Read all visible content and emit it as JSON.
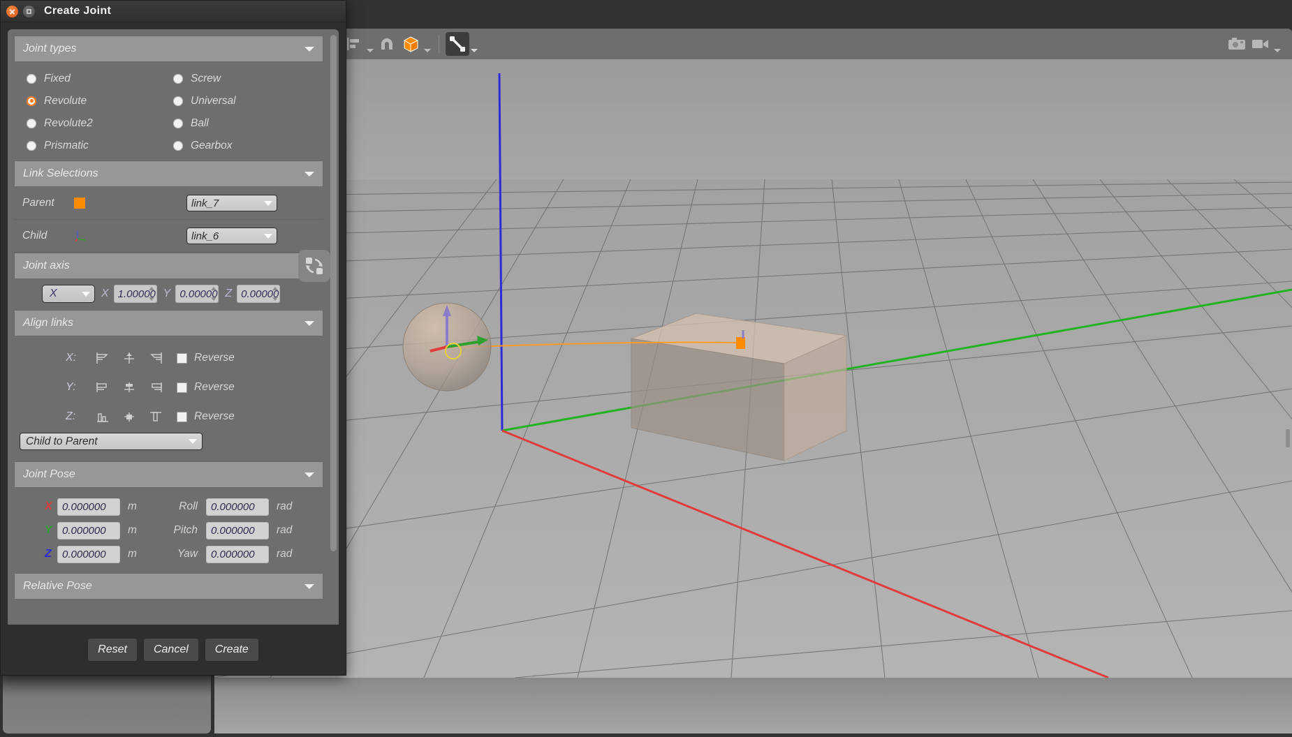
{
  "window": {
    "title": "Create Joint",
    "close_icon": "close-icon",
    "maximize_icon": "maximize-icon"
  },
  "toolbar": {
    "items": [
      {
        "name": "redo-button",
        "icon": "redo-arrow-icon",
        "has_caret": true
      },
      {
        "name": "copy-button",
        "icon": "copy-icon",
        "has_caret": false
      },
      {
        "name": "paste-button",
        "icon": "paste-icon",
        "has_caret": false
      },
      {
        "name": "align-button",
        "icon": "align-icon",
        "has_caret": true
      },
      {
        "name": "snap-button",
        "icon": "magnet-icon",
        "has_caret": false
      },
      {
        "name": "shape-button",
        "icon": "cube-icon",
        "has_caret": true
      },
      {
        "name": "joint-button",
        "icon": "joint-link-icon",
        "has_caret": true,
        "active": true
      }
    ],
    "right_items": [
      {
        "name": "screenshot-button",
        "icon": "camera-icon"
      },
      {
        "name": "record-video-button",
        "icon": "video-camera-icon",
        "has_caret": true
      }
    ],
    "accent_color": "#ff8c00"
  },
  "groups": {
    "joint_types": {
      "title": "Joint types",
      "options": [
        {
          "label": "Fixed",
          "selected": false
        },
        {
          "label": "Screw",
          "selected": false
        },
        {
          "label": "Revolute",
          "selected": true
        },
        {
          "label": "Universal",
          "selected": false
        },
        {
          "label": "Revolute2",
          "selected": false
        },
        {
          "label": "Ball",
          "selected": false
        },
        {
          "label": "Prismatic",
          "selected": false
        },
        {
          "label": "Gearbox",
          "selected": false
        }
      ],
      "selected_value": "Revolute",
      "selected_color": "#ff7a18"
    },
    "link_selections": {
      "title": "Link Selections",
      "parent": {
        "label": "Parent",
        "value": "link_7",
        "marker": "orange-square-marker"
      },
      "child": {
        "label": "Child",
        "value": "link_6",
        "marker": "axes-marker"
      },
      "swap_icon": "swap-links-icon"
    },
    "joint_axis": {
      "title": "Joint axis",
      "preset": "X",
      "x": {
        "label": "X",
        "value": "1.00000"
      },
      "y": {
        "label": "Y",
        "value": "0.00000"
      },
      "z": {
        "label": "Z",
        "value": "0.00000"
      }
    },
    "align_links": {
      "title": "Align links",
      "rows": [
        {
          "axis": "X:",
          "axis_color": "#c9c9d8",
          "reverse_label": "Reverse",
          "reverse_checked": false,
          "icons": [
            "align-x-min-icon",
            "align-x-center-icon",
            "align-x-max-icon"
          ]
        },
        {
          "axis": "Y:",
          "axis_color": "#c9c9d8",
          "reverse_label": "Reverse",
          "reverse_checked": false,
          "icons": [
            "align-y-min-icon",
            "align-y-center-icon",
            "align-y-max-icon"
          ]
        },
        {
          "axis": "Z:",
          "axis_color": "#c9c9d8",
          "reverse_label": "Reverse",
          "reverse_checked": false,
          "icons": [
            "align-z-min-icon",
            "align-z-center-icon",
            "align-z-max-icon"
          ]
        }
      ],
      "direction": "Child to Parent"
    },
    "joint_pose": {
      "title": "Joint Pose",
      "translation": [
        {
          "axis": "X",
          "color": "#e03c3c",
          "value": "0.000000",
          "unit": "m"
        },
        {
          "axis": "Y",
          "color": "#2ea02e",
          "value": "0.000000",
          "unit": "m"
        },
        {
          "axis": "Z",
          "color": "#2b2bd8",
          "value": "0.000000",
          "unit": "m"
        }
      ],
      "rotation": [
        {
          "label": "Roll",
          "value": "0.000000",
          "unit": "rad"
        },
        {
          "label": "Pitch",
          "value": "0.000000",
          "unit": "rad"
        },
        {
          "label": "Yaw",
          "value": "0.000000",
          "unit": "rad"
        }
      ]
    },
    "relative_pose": {
      "title": "Relative Pose"
    }
  },
  "footer": {
    "reset": "Reset",
    "cancel": "Cancel",
    "create": "Create"
  },
  "viewport": {
    "objects": [
      {
        "name": "sphere-link",
        "type": "sphere"
      },
      {
        "name": "box-link",
        "type": "box"
      }
    ],
    "axis_colors": {
      "x": "#e03c3c",
      "y": "#22b222",
      "z": "#2b2bd8"
    },
    "joint_line_color": "#ff9a28"
  }
}
